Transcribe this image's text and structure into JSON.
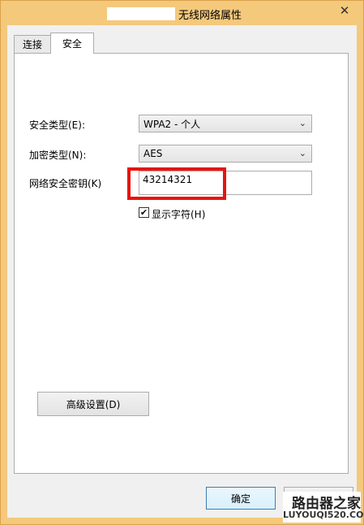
{
  "window": {
    "title": "无线网络属性",
    "close_glyph": "✕"
  },
  "tabs": [
    {
      "label": "连接"
    },
    {
      "label": "安全"
    }
  ],
  "security": {
    "security_type_label": "安全类型(E):",
    "security_type_value": "WPA2 - 个人",
    "encryption_type_label": "加密类型(N):",
    "encryption_type_value": "AES",
    "network_key_label": "网络安全密钥(K)",
    "network_key_value": "43214321",
    "show_chars_label": "显示字符(H)",
    "show_chars_checked": true,
    "checkmark_glyph": "✔",
    "chevron_glyph": "⌄",
    "advanced_button": "高级设置(D)"
  },
  "footer": {
    "ok_button": "确定"
  },
  "watermark": {
    "title": "路由器之家",
    "url": "LUYOUQI520.COM"
  },
  "colors": {
    "frame": "#f4c97c",
    "highlight": "#e8130f"
  }
}
